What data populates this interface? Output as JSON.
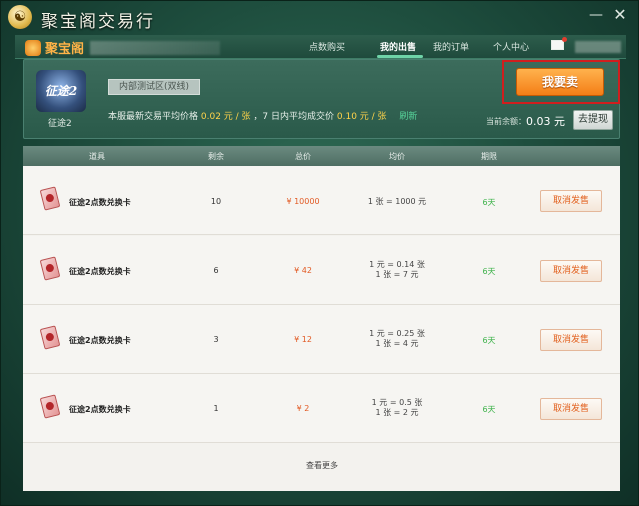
{
  "window": {
    "title": "聚宝阁交易行",
    "logo_glyph": "☯",
    "minimize_glyph": "—",
    "close_glyph": "✕"
  },
  "nav": {
    "brand": "聚宝阁",
    "items": [
      {
        "label": "点数购买",
        "active": false
      },
      {
        "label": "我的出售",
        "active": true
      },
      {
        "label": "我的订单",
        "active": false
      },
      {
        "label": "个人中心",
        "active": false
      }
    ],
    "mail_icon": "mail-icon"
  },
  "info": {
    "game_logo_text": "征途2",
    "game_name": "征途2",
    "server": "内部测试区(双线)",
    "price_prefix": "本服最新交易平均价格",
    "latest_price": "0.02 元 / 张",
    "price_mid": "，7 日内平均成交价",
    "avg7_price": "0.10 元 / 张",
    "refresh": "刷新",
    "sell_button": "我要卖",
    "balance_label": "当前余额：",
    "balance_value": "0.03 元",
    "withdraw_button": "去提现"
  },
  "table": {
    "columns": [
      "道具",
      "剩余",
      "总价",
      "均价",
      "期限"
    ],
    "rows": [
      {
        "name": "征途2点数兑换卡",
        "remaining": "10",
        "total": "¥ 10000",
        "avg_lines": [
          "1 张 = 1000 元"
        ],
        "days": "6天",
        "action": "取消发售"
      },
      {
        "name": "征途2点数兑换卡",
        "remaining": "6",
        "total": "¥ 42",
        "avg_lines": [
          "1 元 = 0.14 张",
          "1 张 = 7 元"
        ],
        "days": "6天",
        "action": "取消发售"
      },
      {
        "name": "征途2点数兑换卡",
        "remaining": "3",
        "total": "¥ 12",
        "avg_lines": [
          "1 元 = 0.25 张",
          "1 张 = 4 元"
        ],
        "days": "6天",
        "action": "取消发售"
      },
      {
        "name": "征途2点数兑换卡",
        "remaining": "1",
        "total": "¥ 2",
        "avg_lines": [
          "1 元 = 0.5 张",
          "1 张 = 2 元"
        ],
        "days": "6天",
        "action": "取消发售"
      }
    ],
    "more": "查看更多"
  },
  "colors": {
    "accent_orange": "#f47e17",
    "price_red": "#e25a24",
    "days_green": "#3db24a",
    "highlight_yellow": "#ffd34a"
  }
}
